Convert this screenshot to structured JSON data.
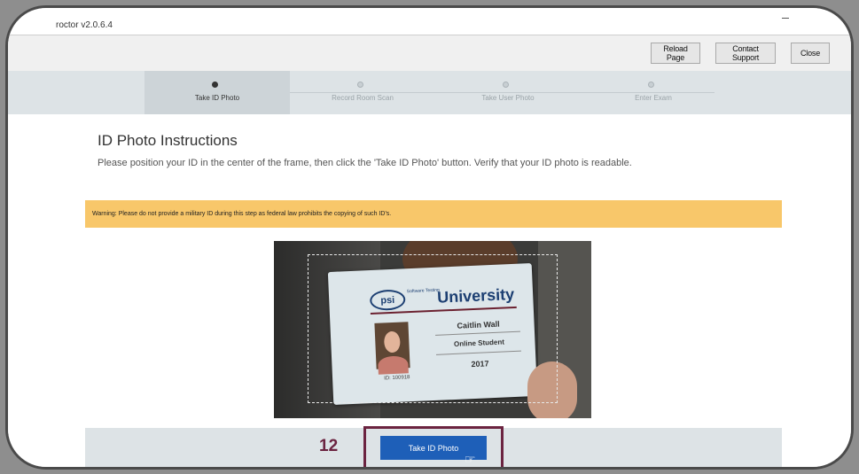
{
  "app": {
    "title": "roctor v2.0.6.4"
  },
  "toolbar": {
    "reload": "Reload Page",
    "support": "Contact Support",
    "close": "Close"
  },
  "steps": [
    {
      "label": "Take ID Photo",
      "active": true
    },
    {
      "label": "Record Room Scan",
      "active": false
    },
    {
      "label": "Take User Photo",
      "active": false
    },
    {
      "label": "Enter Exam",
      "active": false
    }
  ],
  "main": {
    "heading": "ID Photo Instructions",
    "instructions": "Please position your ID in the center of the frame, then click the 'Take ID Photo' button. Verify that your ID photo is readable.",
    "warning": "Warning: Please do not provide a military ID during this step as federal law prohibits the copying of such ID's."
  },
  "idcard": {
    "logo": "psi",
    "logo_sub": "Software Testing",
    "school": "University",
    "name": "Caitlin Wall",
    "role": "Online Student",
    "year": "2017",
    "id": "ID: 100918"
  },
  "action": {
    "take_photo": "Take ID Photo"
  },
  "annotation": {
    "step_number": "12",
    "accent": "#6b2340"
  },
  "colors": {
    "primary_button": "#1e5fb8",
    "warning_bg": "#f8c76a",
    "stepper_bg": "#dde3e6"
  }
}
